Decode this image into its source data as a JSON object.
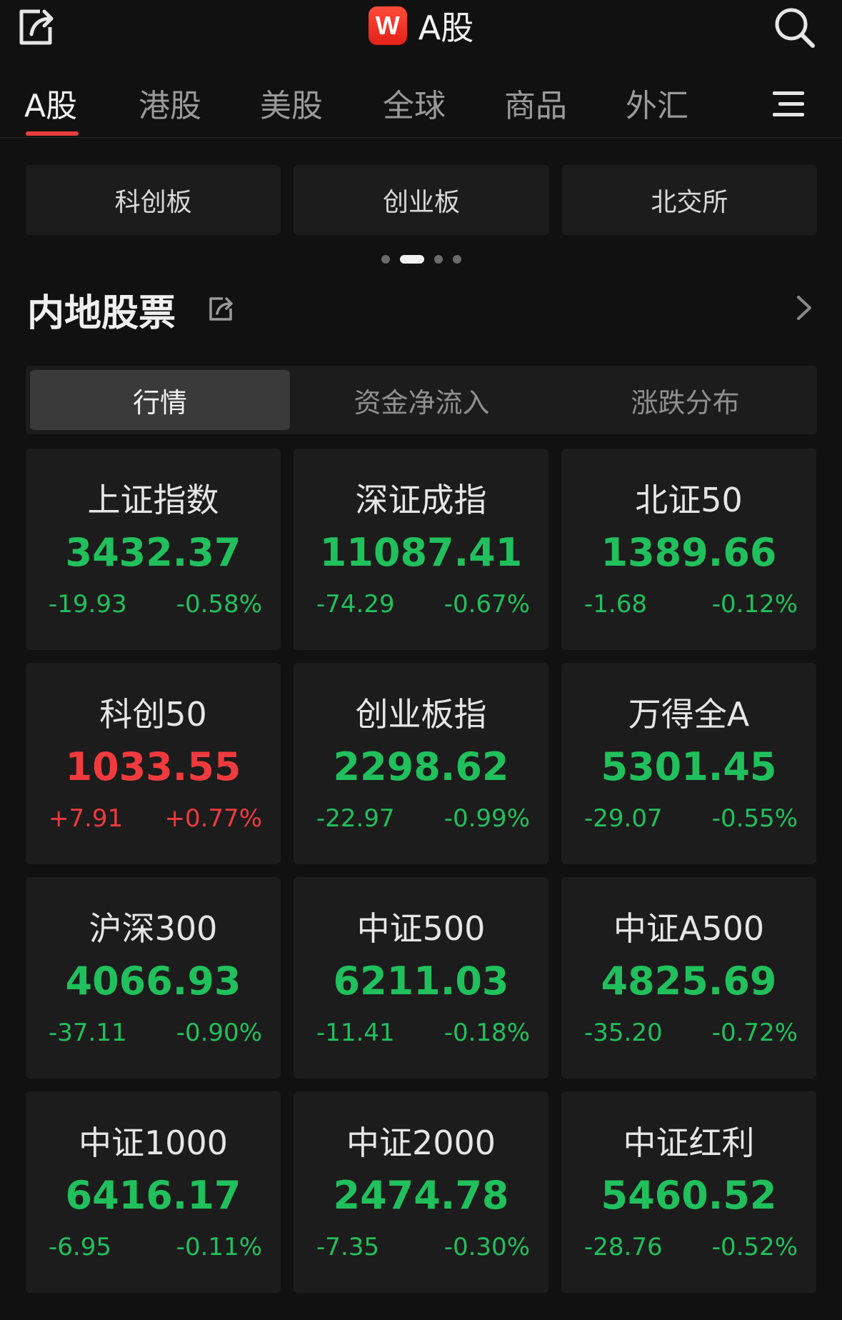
{
  "colors": {
    "up": "#f03a3e",
    "down": "#20c05c"
  },
  "header": {
    "logo_text": "W",
    "title": "A股",
    "share_icon": "share-icon",
    "search_icon": "search-icon"
  },
  "market_tabs": [
    {
      "label": "A股",
      "active": true
    },
    {
      "label": "港股",
      "active": false
    },
    {
      "label": "美股",
      "active": false
    },
    {
      "label": "全球",
      "active": false
    },
    {
      "label": "商品",
      "active": false
    },
    {
      "label": "外汇",
      "active": false
    }
  ],
  "menu_icon": "menu-icon",
  "boards": [
    "科创板",
    "创业板",
    "北交所"
  ],
  "pager": {
    "count": 4,
    "active_index": 1
  },
  "section": {
    "title": "内地股票",
    "share_icon": "share-icon",
    "more_icon": "chevron-right-icon"
  },
  "segments": [
    {
      "label": "行情",
      "active": true
    },
    {
      "label": "资金净流入",
      "active": false
    },
    {
      "label": "涨跌分布",
      "active": false
    }
  ],
  "indices": [
    {
      "name": "上证指数",
      "price": "3432.37",
      "change": "-19.93",
      "pct": "-0.58%",
      "trend": "down"
    },
    {
      "name": "深证成指",
      "price": "11087.41",
      "change": "-74.29",
      "pct": "-0.67%",
      "trend": "down"
    },
    {
      "name": "北证50",
      "price": "1389.66",
      "change": "-1.68",
      "pct": "-0.12%",
      "trend": "down"
    },
    {
      "name": "科创50",
      "price": "1033.55",
      "change": "+7.91",
      "pct": "+0.77%",
      "trend": "up"
    },
    {
      "name": "创业板指",
      "price": "2298.62",
      "change": "-22.97",
      "pct": "-0.99%",
      "trend": "down"
    },
    {
      "name": "万得全A",
      "price": "5301.45",
      "change": "-29.07",
      "pct": "-0.55%",
      "trend": "down"
    },
    {
      "name": "沪深300",
      "price": "4066.93",
      "change": "-37.11",
      "pct": "-0.90%",
      "trend": "down"
    },
    {
      "name": "中证500",
      "price": "6211.03",
      "change": "-11.41",
      "pct": "-0.18%",
      "trend": "down"
    },
    {
      "name": "中证A500",
      "price": "4825.69",
      "change": "-35.20",
      "pct": "-0.72%",
      "trend": "down"
    },
    {
      "name": "中证1000",
      "price": "6416.17",
      "change": "-6.95",
      "pct": "-0.11%",
      "trend": "down"
    },
    {
      "name": "中证2000",
      "price": "2474.78",
      "change": "-7.35",
      "pct": "-0.30%",
      "trend": "down"
    },
    {
      "name": "中证红利",
      "price": "5460.52",
      "change": "-28.76",
      "pct": "-0.52%",
      "trend": "down"
    }
  ]
}
